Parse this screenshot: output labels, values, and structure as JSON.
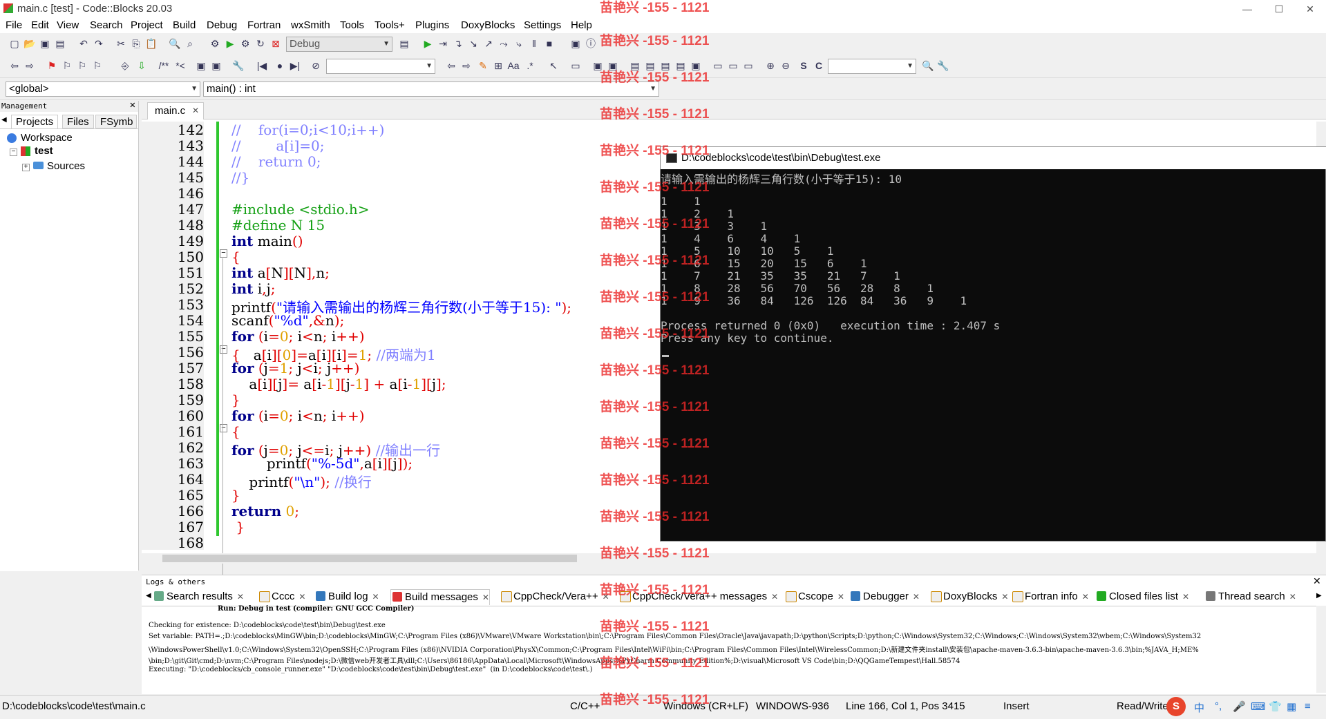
{
  "window": {
    "title": "main.c [test] - Code::Blocks 20.03",
    "min": "—",
    "max": "☐",
    "close": "✕"
  },
  "menu": [
    "File",
    "Edit",
    "View",
    "Search",
    "Project",
    "Build",
    "Debug",
    "Fortran",
    "wxSmith",
    "Tools",
    "Tools+",
    "Plugins",
    "DoxyBlocks",
    "Settings",
    "Help"
  ],
  "toolbar": {
    "build_target": "Debug"
  },
  "scope": {
    "global": "<global>",
    "function": "main() : int"
  },
  "management": {
    "title": "Management",
    "tabs": [
      "Projects",
      "Files",
      "FSymb"
    ],
    "tree": {
      "workspace": "Workspace",
      "project": "test",
      "folder": "Sources"
    }
  },
  "editor": {
    "tab": "main.c",
    "line_numbers": [
      "142",
      "143",
      "144",
      "145",
      "146",
      "147",
      "148",
      "149",
      "150",
      "151",
      "152",
      "153",
      "154",
      "155",
      "156",
      "157",
      "158",
      "159",
      "160",
      "161",
      "162",
      "163",
      "164",
      "165",
      "166",
      "167",
      "168"
    ]
  },
  "console": {
    "title": "D:\\codeblocks\\code\\test\\bin\\Debug\\test.exe",
    "prompt": "请输入需输出的杨辉三角行数(小于等于15): 10",
    "rows": [
      "1    1",
      "1    2    1",
      "1    3    3    1",
      "1    4    6    4    1",
      "1    5    10   10   5    1",
      "1    6    15   20   15   6    1",
      "1    7    21   35   35   21   7    1",
      "1    8    28   56   70   56   28   8    1",
      "1    9    36   84   126  126  84   36   9    1"
    ],
    "process": "Process returned 0 (0x0)   execution time : 2.407 s",
    "continue": "Press any key to continue."
  },
  "logs": {
    "title": "Logs & others",
    "tabs": [
      "Search results",
      "Cccc",
      "Build log",
      "Build messages",
      "CppCheck/Vera++",
      "CppCheck/Vera++ messages",
      "Cscope",
      "Debugger",
      "DoxyBlocks",
      "Fortran info",
      "Closed files list",
      "Thread search"
    ],
    "header": "Run: Debug in test (compiler: GNU GCC Compiler)",
    "lines": [
      "Checking for existence: D:\\codeblocks\\code\\test\\bin\\Debug\\test.exe",
      "Set variable: PATH=.;D:\\codeblocks\\MinGW\\bin;D:\\codeblocks\\MinGW;C:\\Program Files (x86)\\VMware\\VMware Workstation\\bin\\;C:\\Program Files\\Common Files\\Oracle\\Java\\javapath;D:\\python\\Scripts;D:\\python;C:\\Windows\\System32;C:\\Windows;C:\\Windows\\System32\\wbem;C:\\Windows\\System32",
      "\\WindowsPowerShell\\v1.0;C:\\Windows\\System32\\OpenSSH;C:\\Program Files (x86)\\NVIDIA Corporation\\PhysX\\Common;C:\\Program Files\\Intel\\WiFi\\bin;C:\\Program Files\\Common Files\\Intel\\WirelessCommon;D:\\新建文件夹install\\安装包\\apache-maven-3.6.3-bin\\apache-maven-3.6.3\\bin;%JAVA_H;ME%",
      "\\bin;D:\\git\\Git\\cmd;D:\\nvm;C:\\Program Files\\nodejs;D:\\微信web开发者工具\\dll;C:\\Users\\86186\\AppData\\Local\\Microsoft\\WindowsApps;%PyCharm Community Edition%;D:\\visual\\Microsoft VS Code\\bin;D:\\QQGameTempest\\Hall.58574",
      "Executing: \"D:\\codeblocks/cb_console_runner.exe\" \"D:\\codeblocks\\code\\test\\bin\\Debug\\test.exe\"  (in D:\\codeblocks\\code\\test\\.)"
    ]
  },
  "status": {
    "path": "D:\\codeblocks\\code\\test\\main.c",
    "lang": "C/C++",
    "eol": "Windows (CR+LF)",
    "encoding": "WINDOWS-936",
    "position": "Line 166, Col 1, Pos 3415",
    "mode": "Insert",
    "access": "Read/Write",
    "ime": "中"
  },
  "watermark": "苗艳兴 -155 - 1121",
  "colors": {
    "keyword": "#00008b",
    "comment": "#8080ff",
    "preprocessor": "#14a014",
    "operator": "#e00000",
    "string": "#0000ff",
    "number": "#e0a000",
    "watermark": "#eb2828"
  }
}
